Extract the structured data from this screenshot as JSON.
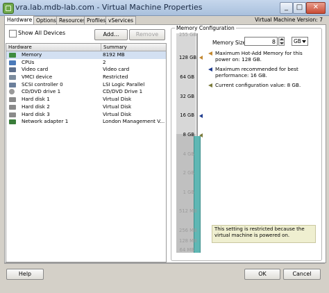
{
  "window": {
    "title": "vra.lab.mdb-lab.com - Virtual Machine Properties",
    "vm_version": "Virtual Machine Version: 7"
  },
  "tabs": [
    "Hardware",
    "Options",
    "Resources",
    "Profiles",
    "vServices"
  ],
  "show_all_devices": {
    "label": "Show All Devices",
    "checked": false
  },
  "buttons": {
    "add": "Add...",
    "remove": "Remove",
    "help": "Help",
    "ok": "OK",
    "cancel": "Cancel"
  },
  "hardware_table": {
    "headers": [
      "Hardware",
      "Summary"
    ],
    "rows": [
      {
        "label": "Memory",
        "summary": "8192 MB",
        "icon": "memory-icon",
        "selected": true
      },
      {
        "label": "CPUs",
        "summary": "2",
        "icon": "cpu-icon"
      },
      {
        "label": "Video card",
        "summary": "Video card",
        "icon": "video-card-icon"
      },
      {
        "label": "VMCI device",
        "summary": "Restricted",
        "icon": "vmci-icon"
      },
      {
        "label": "SCSI controller 0",
        "summary": "LSI Logic Parallel",
        "icon": "scsi-controller-icon"
      },
      {
        "label": "CD/DVD drive 1",
        "summary": "CD/DVD Drive 1",
        "icon": "cd-dvd-icon"
      },
      {
        "label": "Hard disk 1",
        "summary": "Virtual Disk",
        "icon": "hard-disk-icon"
      },
      {
        "label": "Hard disk 2",
        "summary": "Virtual Disk",
        "icon": "hard-disk-icon"
      },
      {
        "label": "Hard disk 3",
        "summary": "Virtual Disk",
        "icon": "hard-disk-icon"
      },
      {
        "label": "Network adapter 1",
        "summary": "London Management V...",
        "icon": "network-adapter-icon"
      }
    ]
  },
  "memory_config": {
    "group_label": "Memory Configuration",
    "size_label": "Memory Size:",
    "size_value": "8",
    "unit": "GB",
    "scale_ticks": [
      "255 GB",
      "128 GB",
      "64 GB",
      "32 GB",
      "16 GB",
      "8 GB",
      "4 GB",
      "2 GB",
      "1 GB",
      "512 MB",
      "256 MB",
      "128 MB",
      "64 MB"
    ],
    "legend": [
      {
        "text": "Maximum Hot-Add Memory for this power on: 128 GB.",
        "color": "#c2872f"
      },
      {
        "text": "Maximum recommended for best performance: 16 GB.",
        "color": "#1f3c8f"
      },
      {
        "text": "Current configuration value: 8 GB.",
        "color": "#7a7a3a"
      }
    ],
    "note": "This setting is restricted because the virtual machine is powered on."
  },
  "colors": {
    "accent": "#5fb7b4",
    "selected_row": "#d3e0f2",
    "title_bar": "#b7cbe4"
  }
}
